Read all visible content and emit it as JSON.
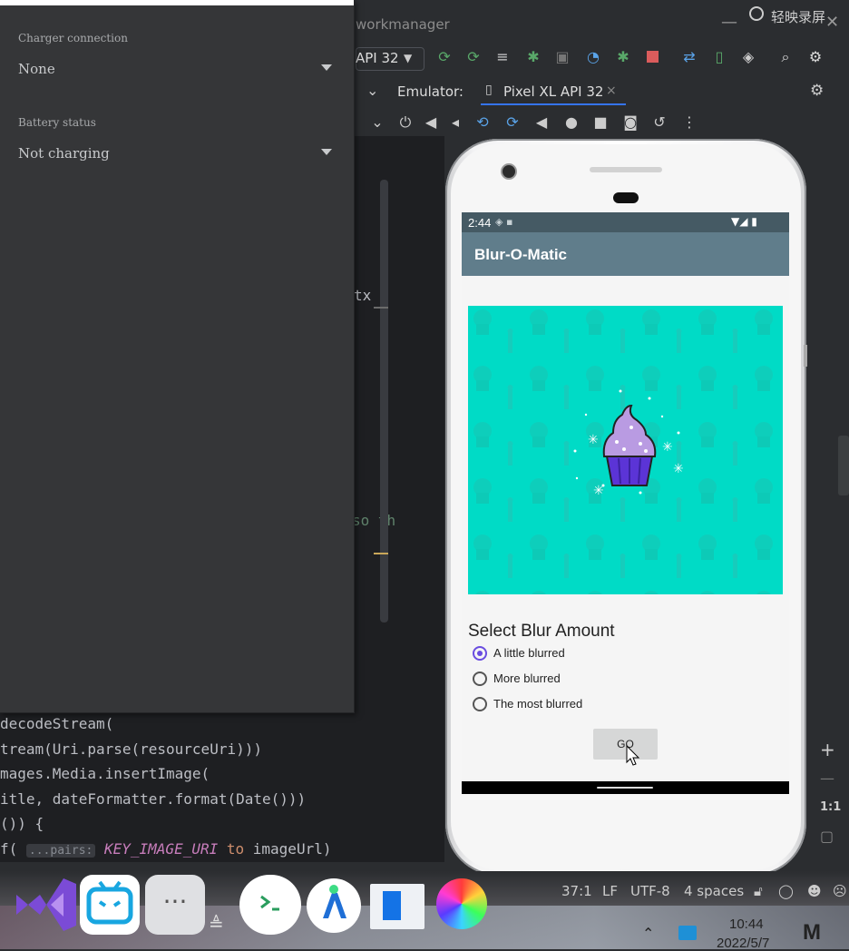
{
  "window": {
    "project_title": "workmanager",
    "recorder_label": "轻映录屏",
    "minimize_glyph": "—",
    "close_glyph": "✕"
  },
  "toolbar": {
    "device_label": "API 32",
    "icons": [
      "run-icon",
      "apply-changes-icon",
      "apply-code-icon",
      "sync-icon",
      "debug-icon",
      "attach-debugger-icon",
      "profiler-icon",
      "debug-bug-icon",
      "stop-icon",
      "sync-gradle-icon",
      "device-manager-icon",
      "sdk-manager-icon",
      "search-icon",
      "settings-icon"
    ]
  },
  "emulator": {
    "label": "Emulator:",
    "tab_label": "Pixel XL API 32",
    "tab_close": "×"
  },
  "settings_panel": {
    "charger_label": "Charger connection",
    "charger_value": "None",
    "battery_label": "Battery status",
    "battery_value": "Not charging"
  },
  "editor": {
    "fragment1": "tx",
    "fragment2": "so th",
    "lines": [
      "decodeStream(",
      "tream(Uri.parse(resourceUri)))",
      "mages.Media.insertImage(",
      "itle, dateFormatter.format(Date()))",
      "()) {",
      "f( ...pairs: KEY_IMAGE_URI to imageUrl)"
    ],
    "hint_pairs": "...pairs:",
    "code_key": "KEY_IMAGE_URI",
    "code_to": "to",
    "code_tail": " imageUrl)"
  },
  "phone": {
    "status_time": "2:44",
    "app_title": "Blur-O-Matic",
    "blur_heading": "Select Blur Amount",
    "options": [
      {
        "label": "A little blurred",
        "checked": true
      },
      {
        "label": "More blurred",
        "checked": false
      },
      {
        "label": "The most blurred",
        "checked": false
      }
    ],
    "go_label": "GO"
  },
  "ide_status": {
    "position": "37:1",
    "line_sep": "LF",
    "encoding": "UTF-8",
    "indent": "4 spaces"
  },
  "right_strip": {
    "zoom_in": "+",
    "zoom_out": "—",
    "ratio": "1:1"
  },
  "taskbar": {
    "clock_time": "10:44",
    "clock_date": "2022/5/7",
    "more_label": "···"
  },
  "colors": {
    "app_bar": "#607d8b",
    "status_bar": "#455a64",
    "image_bg": "#00dbc6",
    "radio_accent": "#6a4de0"
  }
}
